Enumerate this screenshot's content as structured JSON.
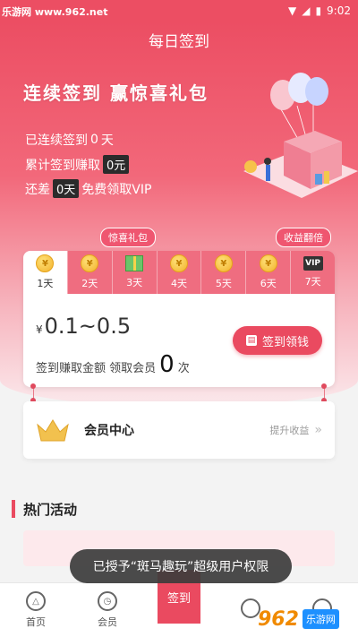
{
  "status_bar": {
    "time": "9:02"
  },
  "watermark": {
    "top_left": "乐游网 www.962.net",
    "brand_num": "962",
    "brand_text": "乐游网"
  },
  "header": {
    "title": "每日签到",
    "slogan": "连续签到 赢惊喜礼包"
  },
  "stats": {
    "continuous_prefix": "已连续签到",
    "continuous_value": "0",
    "continuous_suffix": "天",
    "earned_prefix": "累计签到赚取",
    "earned_value": "0元",
    "remain_prefix": "还差",
    "remain_value": "0天",
    "remain_suffix": "免费领取VIP"
  },
  "bubbles": {
    "surprise": "惊喜礼包",
    "double": "收益翻倍"
  },
  "days": [
    {
      "label": "1天",
      "icon": "coin-icon",
      "active": true
    },
    {
      "label": "2天",
      "icon": "coin-icon"
    },
    {
      "label": "3天",
      "icon": "gift-icon"
    },
    {
      "label": "4天",
      "icon": "coin-icon"
    },
    {
      "label": "5天",
      "icon": "coin-icon"
    },
    {
      "label": "6天",
      "icon": "coin-icon"
    },
    {
      "label": "7天",
      "icon": "vip-icon"
    }
  ],
  "reward": {
    "currency": "¥",
    "range": "0.1~0.5",
    "desc_prefix": "签到赚取金额 领取会员",
    "desc_value": "0",
    "desc_suffix": "次",
    "button": "签到领钱"
  },
  "member": {
    "title": "会员中心",
    "action": "提升收益"
  },
  "section": {
    "title": "热门活动"
  },
  "toast": "已授予“斑马趣玩”超级用户权限",
  "nav": {
    "home": "首页",
    "member": "会员",
    "sign": "签到",
    "fourth": "",
    "mine": ""
  },
  "colors": {
    "accent": "#ea4a60",
    "dark_tag": "#2b2b2b"
  }
}
